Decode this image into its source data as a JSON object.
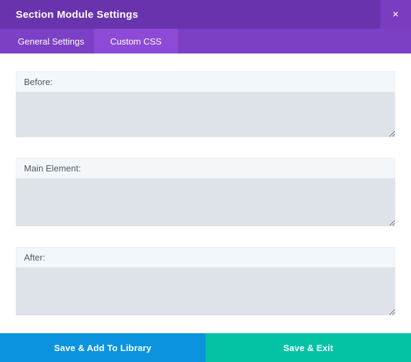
{
  "modal": {
    "title": "Section Module Settings",
    "close_icon": "✕"
  },
  "tabs": [
    {
      "label": "General Settings",
      "active": false
    },
    {
      "label": "Custom CSS",
      "active": true
    }
  ],
  "fields": [
    {
      "label": "Before:",
      "value": ""
    },
    {
      "label": "Main Element:",
      "value": ""
    },
    {
      "label": "After:",
      "value": ""
    }
  ],
  "footer": {
    "buttons": [
      {
        "label": "Save & Add To Library",
        "color": "#0c93de"
      },
      {
        "label": "Save & Exit",
        "color": "#04c3a5"
      }
    ]
  },
  "colors": {
    "header_purple": "#6a33ae",
    "close_button_purple": "#7a3dc0",
    "tab_bar_purple": "#7c40c6",
    "active_tab_purple": "#8c4ad6",
    "field_label_bg": "#f4f7f9",
    "textarea_bg": "#dde3e8",
    "field_label_text": "#4c5867",
    "library_button_blue": "#0c93de",
    "save_exit_teal": "#04c3a5"
  }
}
